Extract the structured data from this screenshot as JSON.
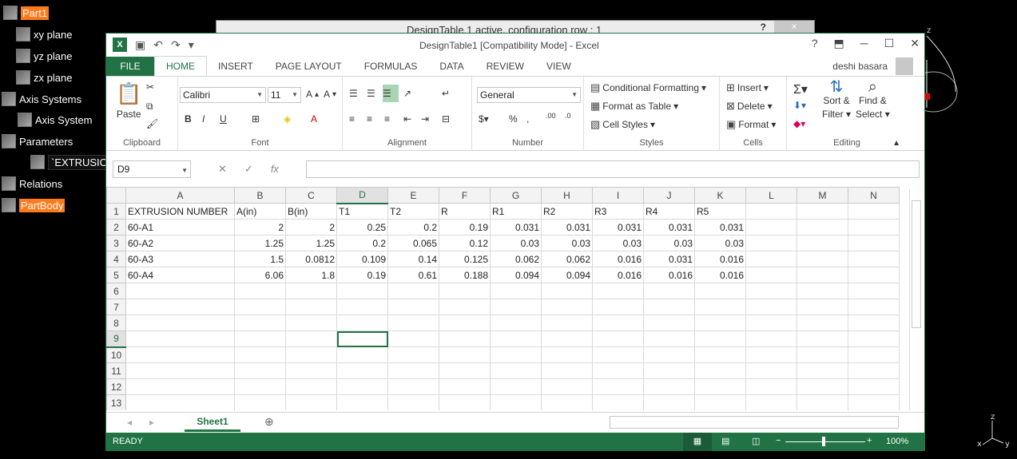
{
  "tree": {
    "items": [
      {
        "label": "Part1",
        "style": "hl"
      },
      {
        "label": "xy plane",
        "style": ""
      },
      {
        "label": "yz plane",
        "style": ""
      },
      {
        "label": "zx plane",
        "style": ""
      },
      {
        "label": "Axis Systems",
        "style": ""
      },
      {
        "label": "Axis System",
        "style": ""
      },
      {
        "label": "Parameters",
        "style": ""
      },
      {
        "label": "`EXTRUSION",
        "style": "dark"
      },
      {
        "label": "Relations",
        "style": ""
      },
      {
        "label": "PartBody",
        "style": "hl"
      }
    ]
  },
  "back_dialog": {
    "title": "DesignTable.1 active, configuration row : 1",
    "help": "?",
    "close": "×"
  },
  "excel": {
    "title": "DesignTable1  [Compatibility Mode] - Excel",
    "user": "deshi basara",
    "tabs": [
      "FILE",
      "HOME",
      "INSERT",
      "PAGE LAYOUT",
      "FORMULAS",
      "DATA",
      "REVIEW",
      "VIEW"
    ],
    "ribbon": {
      "clipboard": {
        "label": "Clipboard",
        "paste": "Paste"
      },
      "font": {
        "label": "Font",
        "name": "Calibri",
        "size": "11",
        "bold": "B",
        "italic": "I",
        "underline": "U"
      },
      "alignment": {
        "label": "Alignment"
      },
      "number": {
        "label": "Number",
        "format": "General",
        "percent": "%"
      },
      "styles": {
        "label": "Styles",
        "cond": "Conditional Formatting",
        "table": "Format as Table",
        "cell": "Cell Styles"
      },
      "cells": {
        "label": "Cells",
        "insert": "Insert",
        "delete": "Delete",
        "format": "Format"
      },
      "editing": {
        "label": "Editing",
        "sort": "Sort &",
        "filter": "Filter",
        "find": "Find &",
        "select": "Select"
      }
    },
    "namebox": "D9",
    "columns": [
      "A",
      "B",
      "C",
      "D",
      "E",
      "F",
      "G",
      "H",
      "I",
      "J",
      "K",
      "L",
      "M",
      "N"
    ],
    "selected_column": "D",
    "selected_row": 9,
    "rows": [
      [
        "EXTRUSION NUMBER",
        "A(in)",
        "B(in)",
        "T1",
        "T2",
        "R",
        "R1",
        "R2",
        "R3",
        "R4",
        "R5",
        "",
        "",
        ""
      ],
      [
        "60-A1",
        "2",
        "2",
        "0.25",
        "0.2",
        "0.19",
        "0.031",
        "0.031",
        "0.031",
        "0.031",
        "0.031",
        "",
        "",
        ""
      ],
      [
        "60-A2",
        "1.25",
        "1.25",
        "0.2",
        "0.065",
        "0.12",
        "0.03",
        "0.03",
        "0.03",
        "0.03",
        "0.03",
        "",
        "",
        ""
      ],
      [
        "60-A3",
        "1.5",
        "0.0812",
        "0.109",
        "0.14",
        "0.125",
        "0.062",
        "0.062",
        "0.016",
        "0.031",
        "0.016",
        "",
        "",
        ""
      ],
      [
        "60-A4",
        "6.06",
        "1.8",
        "0.19",
        "0.61",
        "0.188",
        "0.094",
        "0.094",
        "0.016",
        "0.016",
        "0.016",
        "",
        "",
        ""
      ],
      [
        "",
        "",
        "",
        "",
        "",
        "",
        "",
        "",
        "",
        "",
        "",
        "",
        "",
        ""
      ],
      [
        "",
        "",
        "",
        "",
        "",
        "",
        "",
        "",
        "",
        "",
        "",
        "",
        "",
        ""
      ],
      [
        "",
        "",
        "",
        "",
        "",
        "",
        "",
        "",
        "",
        "",
        "",
        "",
        "",
        ""
      ],
      [
        "",
        "",
        "",
        "",
        "",
        "",
        "",
        "",
        "",
        "",
        "",
        "",
        "",
        ""
      ],
      [
        "",
        "",
        "",
        "",
        "",
        "",
        "",
        "",
        "",
        "",
        "",
        "",
        "",
        ""
      ],
      [
        "",
        "",
        "",
        "",
        "",
        "",
        "",
        "",
        "",
        "",
        "",
        "",
        "",
        ""
      ],
      [
        "",
        "",
        "",
        "",
        "",
        "",
        "",
        "",
        "",
        "",
        "",
        "",
        "",
        ""
      ],
      [
        "",
        "",
        "",
        "",
        "",
        "",
        "",
        "",
        "",
        "",
        "",
        "",
        "",
        ""
      ]
    ],
    "sheet_tab": "Sheet1",
    "status": "READY",
    "zoom": "100%"
  },
  "compass_label": "z",
  "axes_labels": {
    "z": "z",
    "x": "x",
    "y": "y"
  }
}
